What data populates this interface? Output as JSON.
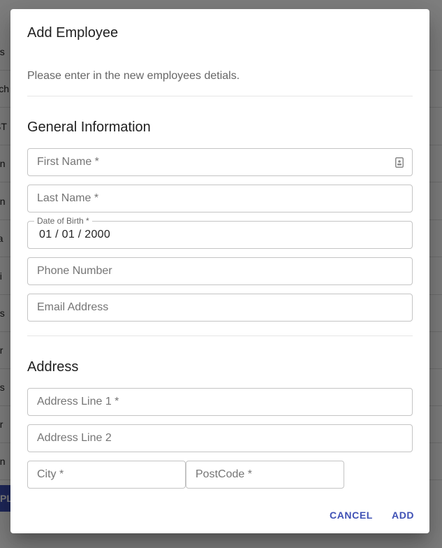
{
  "background": {
    "rows": [
      "irs",
      "lich",
      "ST",
      "on",
      "en",
      "ra",
      "ai",
      "es",
      "ar",
      "as",
      "ar",
      "en"
    ],
    "button_label": "PL"
  },
  "dialog": {
    "title": "Add Employee",
    "description": "Please enter in the new employees detials.",
    "general_section": {
      "title": "General Information",
      "first_name": "First Name *",
      "last_name": "Last Name *",
      "dob_label": "Date of Birth *",
      "dob_value": "01 / 01 / 2000",
      "phone": "Phone Number",
      "email": "Email Address"
    },
    "address_section": {
      "title": "Address",
      "line1": "Address Line 1 *",
      "line2": "Address Line 2",
      "city": "City *",
      "postcode": "PostCode *"
    },
    "actions": {
      "cancel": "CANCEL",
      "add": "ADD"
    }
  },
  "colors": {
    "accent": "#3f51b5",
    "scrim": "rgba(0,0,0,0.5)"
  },
  "icons": {
    "first_name_trailing": "contact-card-icon"
  }
}
